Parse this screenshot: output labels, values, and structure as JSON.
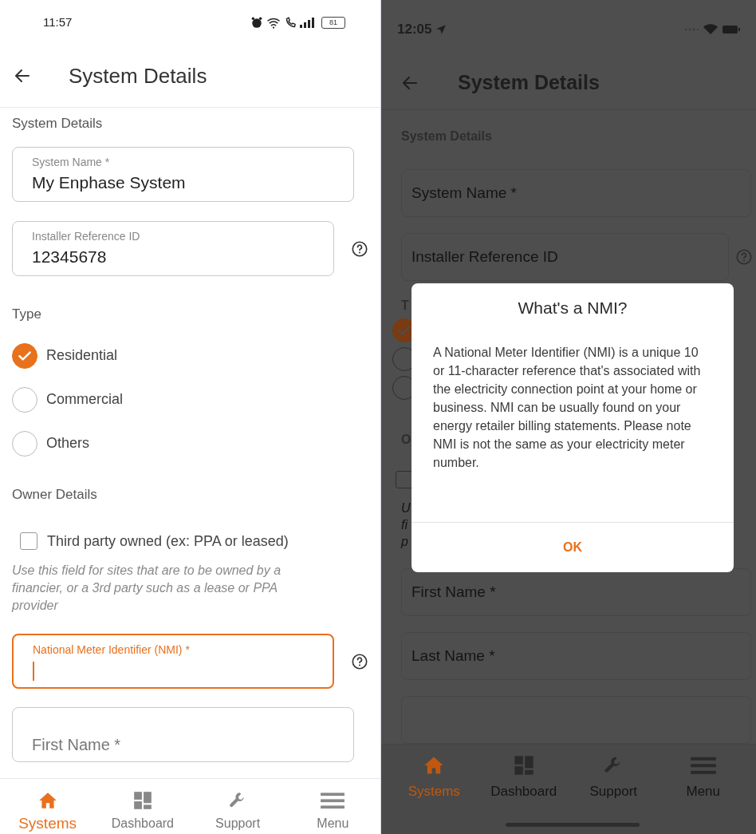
{
  "screens": [
    {
      "kind": "android",
      "status_bar": {
        "time": "11:57",
        "battery": "81"
      },
      "header": {
        "title": "System Details"
      },
      "items": [
        {
          "kind": "section",
          "text": "System Details"
        },
        {
          "kind": "field",
          "label": "System Name *",
          "value": "My Enphase System",
          "focused": false,
          "help": false
        },
        {
          "kind": "field",
          "label": "Installer Reference ID",
          "value": "12345678",
          "focused": false,
          "help": true
        },
        {
          "kind": "section",
          "text": "Type"
        },
        {
          "kind": "radio",
          "label": "Residential",
          "selected": true
        },
        {
          "kind": "radio",
          "label": "Commercial",
          "selected": false
        },
        {
          "kind": "radio",
          "label": "Others",
          "selected": false
        },
        {
          "kind": "section",
          "text": "Owner Details"
        },
        {
          "kind": "checkbox",
          "label": "Third party owned (ex: PPA or leased)",
          "checked": false
        },
        {
          "kind": "hint",
          "lines": [
            "Use this field for sites that are to be owned by a",
            "financier, or a 3rd party such as a lease or PPA",
            "provider"
          ]
        },
        {
          "kind": "field",
          "label": "National Meter Identifier (NMI) *",
          "focused": true,
          "help": true
        },
        {
          "kind": "field",
          "label": "First Name *",
          "focused": false,
          "help": false
        }
      ],
      "nav": [
        {
          "label": "Systems",
          "selected": true
        },
        {
          "label": "Dashboard",
          "selected": false
        },
        {
          "label": "Support",
          "selected": false
        },
        {
          "label": "Menu",
          "selected": false
        }
      ]
    },
    {
      "kind": "ios",
      "status_bar": {
        "time": "12:05"
      },
      "header": {
        "title": "System Details"
      },
      "items": [
        {
          "kind": "section",
          "text": "System Details"
        },
        {
          "kind": "field",
          "label": "System Name *",
          "focused": false,
          "help": false
        },
        {
          "kind": "field",
          "label": "Installer Reference ID",
          "focused": false,
          "help": true
        },
        {
          "kind": "section",
          "text": "T"
        },
        {
          "kind": "radio",
          "selected": true
        },
        {
          "kind": "radio",
          "selected": false
        },
        {
          "kind": "radio",
          "selected": false
        },
        {
          "kind": "section",
          "text": "O"
        },
        {
          "kind": "checkbox",
          "checked": false
        },
        {
          "kind": "hint",
          "lines": [
            "U",
            "fi",
            "p"
          ]
        },
        {
          "kind": "field",
          "label": "First Name *",
          "focused": false,
          "help": false
        },
        {
          "kind": "field",
          "label": "Last Name *",
          "focused": false,
          "help": false
        },
        {
          "kind": "field",
          "focused": false,
          "help": false
        }
      ],
      "dialog": {
        "title": "What's a NMI?",
        "body": "A National Meter Identifier (NMI) is a unique 10 or 11-character reference that's associated with the electricity connection point at your home or business. NMI can be usually found on your energy retailer billing statements. Please note NMI is not the same as your electricity meter number.",
        "button": "OK"
      },
      "nav": [
        {
          "label": "Systems",
          "selected": true
        },
        {
          "label": "Dashboard",
          "selected": false
        },
        {
          "label": "Support",
          "selected": false
        },
        {
          "label": "Menu",
          "selected": false
        }
      ]
    }
  ]
}
